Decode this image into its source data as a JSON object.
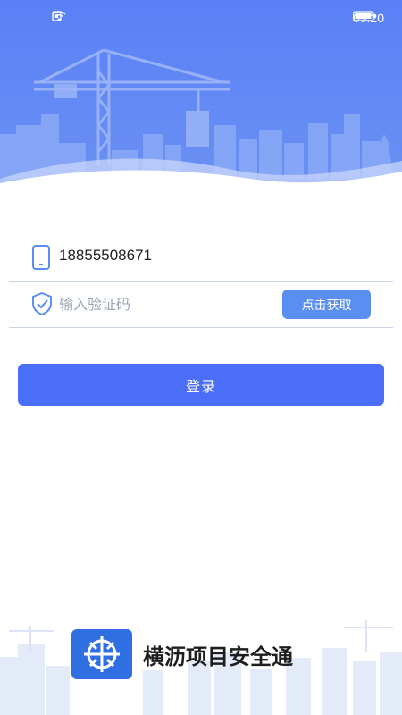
{
  "status_bar": {
    "time": "09:20"
  },
  "login": {
    "phone_value": "18855508671",
    "code_placeholder": "输入验证码",
    "get_code_label": "点击获取",
    "login_label": "登录"
  },
  "brand": {
    "app_name": "横沥项目安全通"
  },
  "colors": {
    "header": "#5b82f5",
    "primary": "#4a6ef7",
    "secondary_button": "#5a8ef0"
  },
  "icons": [
    "phone-icon",
    "shield-check-icon",
    "app-logo-icon",
    "wifi-icon",
    "battery-icon",
    "sim-icon"
  ]
}
